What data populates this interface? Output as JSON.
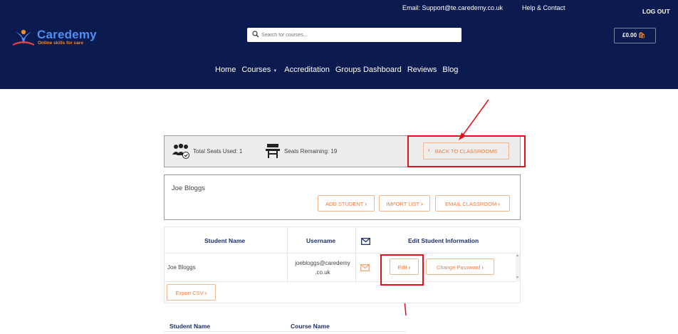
{
  "topbar": {
    "email": "Email: Support@te.caredemy.co.uk",
    "help": "Help & Contact",
    "logout": "LOG OUT"
  },
  "logo": {
    "brand": "Caredemy",
    "tagline": "Online skills for care"
  },
  "search": {
    "placeholder": "Search for courses..."
  },
  "cart": {
    "amount": "£0.00"
  },
  "nav": {
    "items": [
      "Home",
      "Courses",
      "Accreditation",
      "Groups Dashboard",
      "Reviews",
      "Blog"
    ]
  },
  "stats": {
    "seats_used": "Total Seats Used: 1",
    "seats_remaining": "Seats Remaining: 19",
    "back_label": "BACK TO CLASSROOMS"
  },
  "classroom": {
    "name": "Joe Bloggs",
    "add_student": "ADD STUDENT",
    "import_list": "IMPORT LIST",
    "email_classroom": "EMAIL CLASSROOM"
  },
  "students_table": {
    "headers": {
      "name": "Student Name",
      "username": "Username",
      "edit": "Edit Student Information"
    },
    "rows": [
      {
        "name": "Joe Bloggs",
        "username_line1": "joebloggs@caredemy",
        "username_line2": ".co.uk",
        "edit": "Edit",
        "change_password": "Change Password"
      }
    ],
    "export": "Export CSV"
  },
  "courses_table": {
    "headers": {
      "student": "Student Name",
      "course": "Course Name"
    }
  },
  "colors": {
    "header_bg": "#0b1a4f",
    "accent": "#f07c3c",
    "highlight": "#e2111a",
    "table_header": "#1f2f6b"
  }
}
